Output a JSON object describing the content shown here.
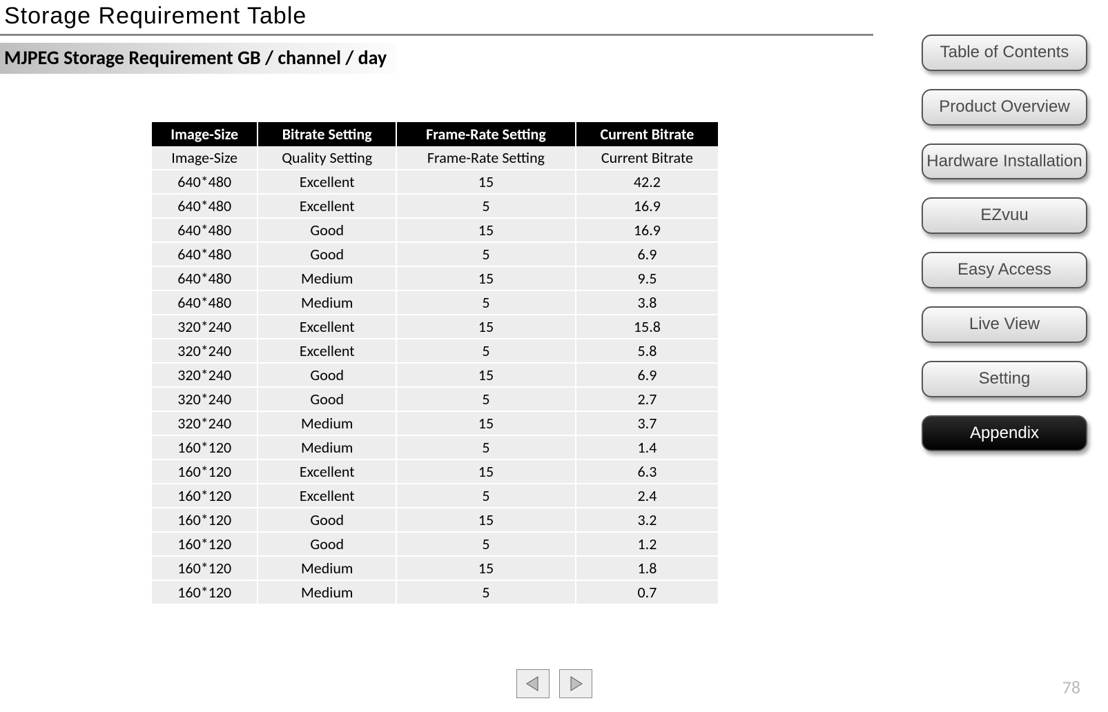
{
  "title": "Storage Requirement Table",
  "subheading": "MJPEG Storage Requirement GB / channel / day",
  "table": {
    "headers": [
      "Image-Size",
      "Bitrate Setting",
      "Frame-Rate Setting",
      "Current Bitrate"
    ],
    "rows": [
      [
        "Image-Size",
        "Quality Setting",
        "Frame-Rate Setting",
        "Current Bitrate"
      ],
      [
        "640*480",
        "Excellent",
        "15",
        "42.2"
      ],
      [
        "640*480",
        "Excellent",
        "5",
        "16.9"
      ],
      [
        "640*480",
        "Good",
        "15",
        "16.9"
      ],
      [
        "640*480",
        "Good",
        "5",
        "6.9"
      ],
      [
        "640*480",
        "Medium",
        "15",
        "9.5"
      ],
      [
        "640*480",
        "Medium",
        "5",
        "3.8"
      ],
      [
        "320*240",
        "Excellent",
        "15",
        "15.8"
      ],
      [
        "320*240",
        "Excellent",
        "5",
        "5.8"
      ],
      [
        "320*240",
        "Good",
        "15",
        "6.9"
      ],
      [
        "320*240",
        "Good",
        "5",
        "2.7"
      ],
      [
        "320*240",
        "Medium",
        "15",
        "3.7"
      ],
      [
        "160*120",
        "Medium",
        "5",
        "1.4"
      ],
      [
        "160*120",
        "Excellent",
        "15",
        "6.3"
      ],
      [
        "160*120",
        "Excellent",
        "5",
        "2.4"
      ],
      [
        "160*120",
        "Good",
        "15",
        "3.2"
      ],
      [
        "160*120",
        "Good",
        "5",
        "1.2"
      ],
      [
        "160*120",
        "Medium",
        "15",
        "1.8"
      ],
      [
        "160*120",
        "Medium",
        "5",
        "0.7"
      ]
    ]
  },
  "sidebar": [
    {
      "label": "Table of Contents",
      "active": false
    },
    {
      "label": "Product Overview",
      "active": false
    },
    {
      "label": "Hardware Installation",
      "active": false
    },
    {
      "label": "EZvuu",
      "active": false
    },
    {
      "label": "Easy Access",
      "active": false
    },
    {
      "label": "Live View",
      "active": false
    },
    {
      "label": "Setting",
      "active": false
    },
    {
      "label": "Appendix",
      "active": true
    }
  ],
  "pager": {
    "prev": "Previous",
    "next": "Next"
  },
  "page_number": "78"
}
